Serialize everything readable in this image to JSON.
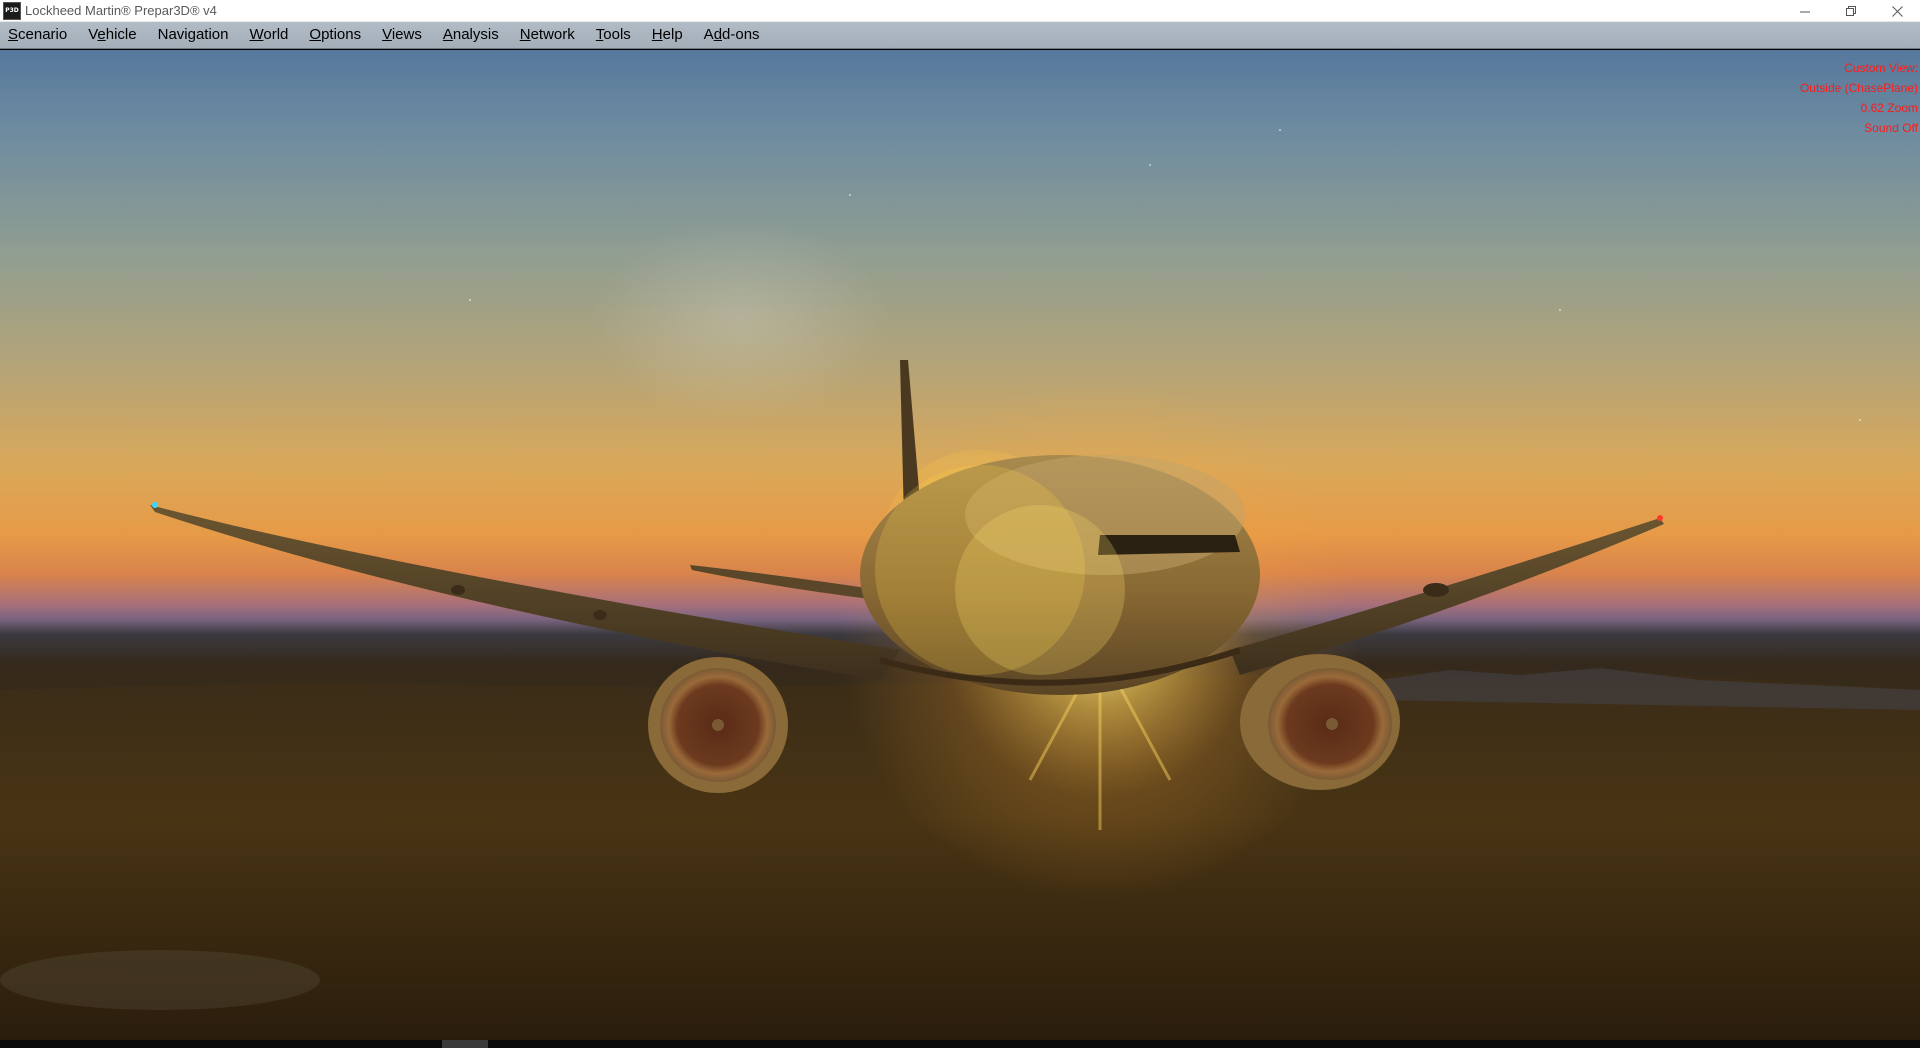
{
  "window": {
    "title": "Lockheed Martin® Prepar3D® v4",
    "app_icon_text": "P3D",
    "controls": {
      "minimize": "minimize-icon",
      "restore": "restore-icon",
      "close": "close-icon"
    }
  },
  "menu": {
    "items": [
      {
        "mnemonic": "S",
        "rest": "cenario"
      },
      {
        "pre": "V",
        "mnemonic": "e",
        "rest": "hicle"
      },
      {
        "pre": "Navi",
        "mnemonic": "g",
        "rest": "ation"
      },
      {
        "mnemonic": "W",
        "rest": "orld"
      },
      {
        "mnemonic": "O",
        "rest": "ptions"
      },
      {
        "mnemonic": "V",
        "rest": "iews"
      },
      {
        "mnemonic": "A",
        "rest": "nalysis"
      },
      {
        "mnemonic": "N",
        "rest": "etwork"
      },
      {
        "mnemonic": "T",
        "rest": "ools"
      },
      {
        "mnemonic": "H",
        "rest": "elp"
      },
      {
        "pre": "A",
        "mnemonic": "d",
        "rest": "d-ons"
      }
    ]
  },
  "hud": {
    "view_label": "Custom View:",
    "view_mode": "Outside (ChasePlane)",
    "zoom": "0.62 Zoom",
    "sound": "Sound Off"
  },
  "colors": {
    "hud_text": "#ff1a1a",
    "menubar": "#a9b4bf"
  }
}
